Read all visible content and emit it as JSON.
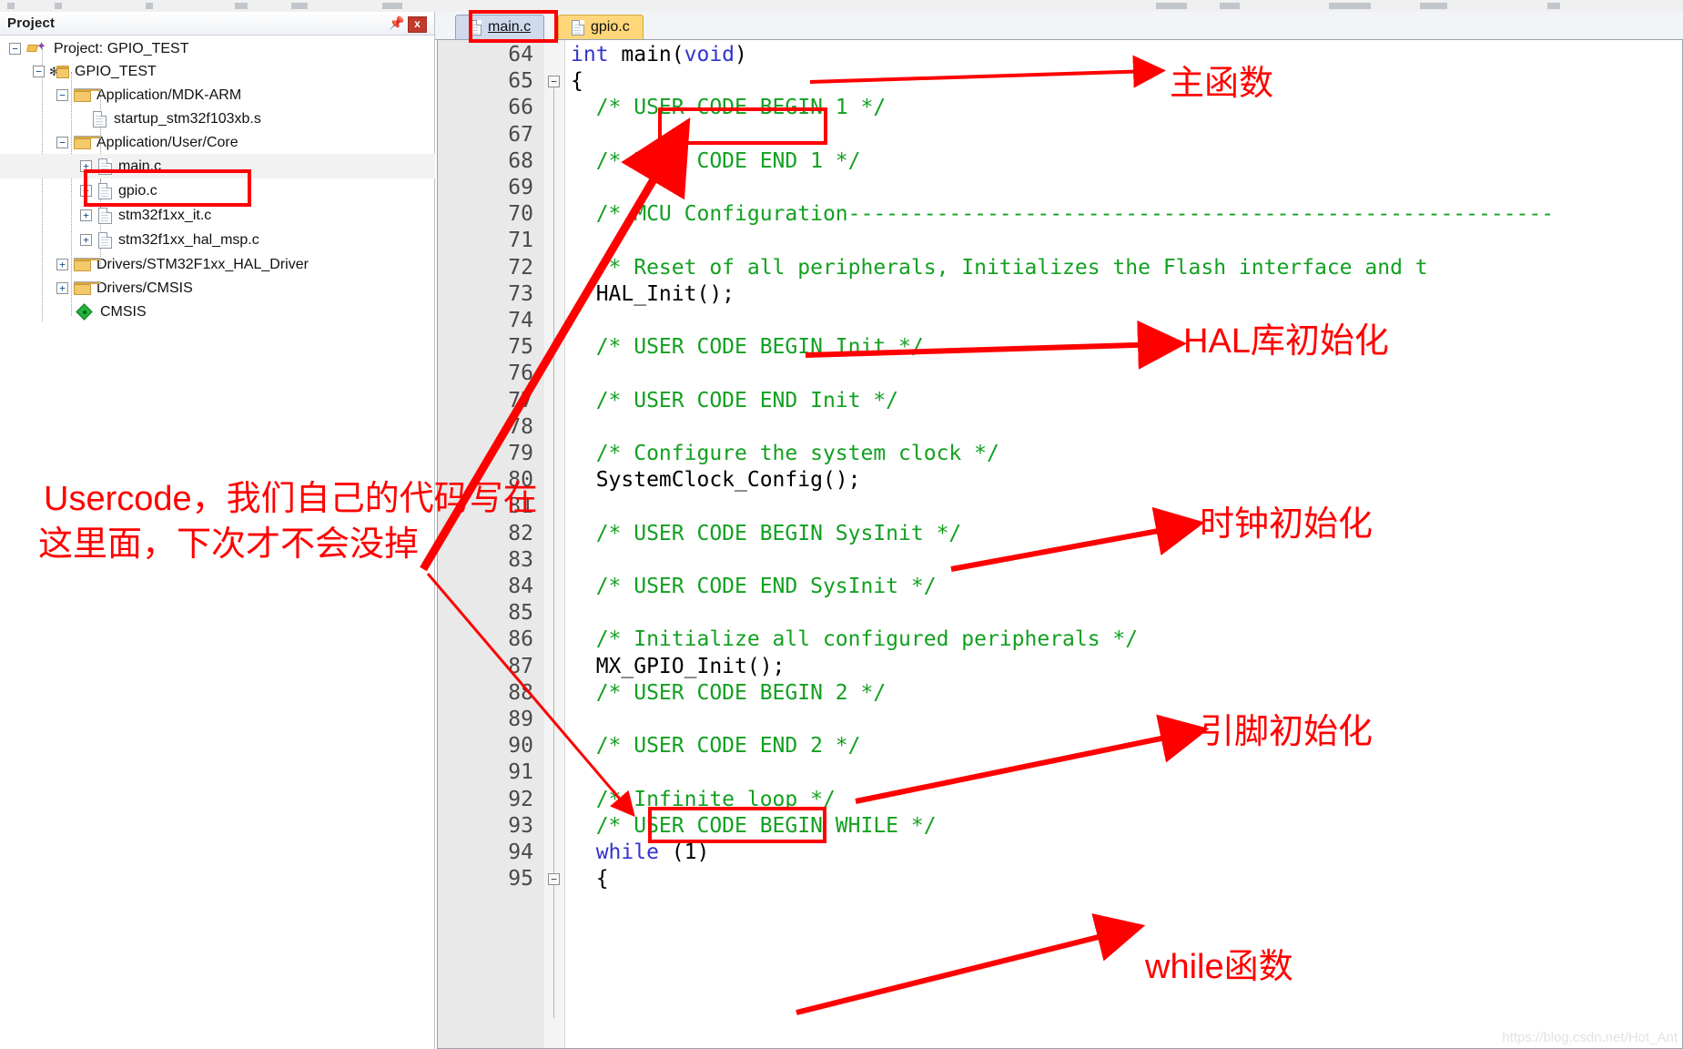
{
  "window": {
    "project_panel_title": "Project",
    "pin_icon": "pin-icon",
    "close_icon": "x"
  },
  "toolbar": {
    "icons": [
      "new-file-icon",
      "open-icon",
      "save-icon",
      "cut-icon",
      "copy-icon",
      "paste-icon",
      "undo-icon",
      "redo-icon",
      "build-icon",
      "debug-icon",
      "target-select",
      "options-icon"
    ]
  },
  "project_tree": [
    {
      "label": "Project: GPIO_TEST",
      "icon": "project-icon",
      "indent": 0,
      "expander": "-",
      "selected": false
    },
    {
      "label": "GPIO_TEST",
      "icon": "target-icon",
      "indent": 1,
      "expander": "-",
      "selected": false
    },
    {
      "label": "Application/MDK-ARM",
      "icon": "folder-icon",
      "indent": 2,
      "expander": "-",
      "selected": false
    },
    {
      "label": "startup_stm32f103xb.s",
      "icon": "file-icon",
      "indent": 3,
      "expander": "",
      "selected": false
    },
    {
      "label": "Application/User/Core",
      "icon": "folder-icon",
      "indent": 2,
      "expander": "-",
      "selected": false
    },
    {
      "label": "main.c",
      "icon": "file-icon",
      "indent": 3,
      "expander": "+",
      "selected": true
    },
    {
      "label": "gpio.c",
      "icon": "file-icon",
      "indent": 3,
      "expander": "+",
      "selected": false
    },
    {
      "label": "stm32f1xx_it.c",
      "icon": "file-icon",
      "indent": 3,
      "expander": "+",
      "selected": false
    },
    {
      "label": "stm32f1xx_hal_msp.c",
      "icon": "file-icon",
      "indent": 3,
      "expander": "+",
      "selected": false
    },
    {
      "label": "Drivers/STM32F1xx_HAL_Driver",
      "icon": "folder-icon",
      "indent": 2,
      "expander": "+",
      "selected": false
    },
    {
      "label": "Drivers/CMSIS",
      "icon": "folder-icon",
      "indent": 2,
      "expander": "+",
      "selected": false
    },
    {
      "label": "CMSIS",
      "icon": "cmsis-icon",
      "indent": 2,
      "expander": "",
      "selected": false
    }
  ],
  "editor": {
    "tabs": [
      {
        "label": "main.c",
        "active": true,
        "icon": "file-icon"
      },
      {
        "label": "gpio.c",
        "active": false,
        "icon": "file-icon"
      }
    ],
    "first_line": 64,
    "lines": [
      {
        "n": 64,
        "fold": "",
        "parts": [
          {
            "t": "int ",
            "c": "kw"
          },
          {
            "t": "main(",
            "c": "pln"
          },
          {
            "t": "void",
            "c": "kw"
          },
          {
            "t": ")",
            "c": "pln"
          }
        ]
      },
      {
        "n": 65,
        "fold": "-",
        "parts": [
          {
            "t": "{",
            "c": "pln"
          }
        ]
      },
      {
        "n": 66,
        "fold": "",
        "parts": [
          {
            "t": "  /* USER CODE BEGIN 1 */",
            "c": "com"
          }
        ]
      },
      {
        "n": 67,
        "fold": "",
        "parts": []
      },
      {
        "n": 68,
        "fold": "",
        "parts": [
          {
            "t": "  /* USER CODE END 1 */",
            "c": "com"
          }
        ]
      },
      {
        "n": 69,
        "fold": "",
        "parts": []
      },
      {
        "n": 70,
        "fold": "",
        "parts": [
          {
            "t": "  /* MCU Configuration--------------------------------------------------------",
            "c": "com"
          }
        ]
      },
      {
        "n": 71,
        "fold": "",
        "parts": []
      },
      {
        "n": 72,
        "fold": "",
        "parts": [
          {
            "t": "  /* Reset of all peripherals, Initializes the Flash interface and t",
            "c": "com"
          }
        ]
      },
      {
        "n": 73,
        "fold": "",
        "parts": [
          {
            "t": "  HAL_Init();",
            "c": "pln"
          }
        ]
      },
      {
        "n": 74,
        "fold": "",
        "parts": []
      },
      {
        "n": 75,
        "fold": "",
        "parts": [
          {
            "t": "  /* USER CODE BEGIN Init */",
            "c": "com"
          }
        ]
      },
      {
        "n": 76,
        "fold": "",
        "parts": []
      },
      {
        "n": 77,
        "fold": "",
        "parts": [
          {
            "t": "  /* USER CODE END Init */",
            "c": "com"
          }
        ]
      },
      {
        "n": 78,
        "fold": "",
        "parts": []
      },
      {
        "n": 79,
        "fold": "",
        "parts": [
          {
            "t": "  /* Configure the system clock */",
            "c": "com"
          }
        ]
      },
      {
        "n": 80,
        "fold": "",
        "parts": [
          {
            "t": "  SystemClock_Config();",
            "c": "pln"
          }
        ]
      },
      {
        "n": 81,
        "fold": "",
        "parts": []
      },
      {
        "n": 82,
        "fold": "",
        "parts": [
          {
            "t": "  /* USER CODE BEGIN SysInit */",
            "c": "com"
          }
        ]
      },
      {
        "n": 83,
        "fold": "",
        "parts": []
      },
      {
        "n": 84,
        "fold": "",
        "parts": [
          {
            "t": "  /* USER CODE END SysInit */",
            "c": "com"
          }
        ]
      },
      {
        "n": 85,
        "fold": "",
        "parts": []
      },
      {
        "n": 86,
        "fold": "",
        "parts": [
          {
            "t": "  /* Initialize all configured peripherals */",
            "c": "com"
          }
        ]
      },
      {
        "n": 87,
        "fold": "",
        "parts": [
          {
            "t": "  MX_GPIO_Init();",
            "c": "pln"
          }
        ]
      },
      {
        "n": 88,
        "fold": "",
        "parts": [
          {
            "t": "  /* USER CODE BEGIN 2 */",
            "c": "com"
          }
        ]
      },
      {
        "n": 89,
        "fold": "",
        "parts": []
      },
      {
        "n": 90,
        "fold": "",
        "parts": [
          {
            "t": "  /* USER CODE END 2 */",
            "c": "com"
          }
        ]
      },
      {
        "n": 91,
        "fold": "",
        "parts": []
      },
      {
        "n": 92,
        "fold": "",
        "parts": [
          {
            "t": "  /* Infinite loop */",
            "c": "com"
          }
        ]
      },
      {
        "n": 93,
        "fold": "",
        "parts": [
          {
            "t": "  /* USER CODE BEGIN WHILE */",
            "c": "com"
          }
        ]
      },
      {
        "n": 94,
        "fold": "",
        "parts": [
          {
            "t": "  while",
            "c": "kw"
          },
          {
            "t": " (1)",
            "c": "pln"
          }
        ]
      },
      {
        "n": 95,
        "fold": "-",
        "parts": [
          {
            "t": "  {",
            "c": "pln"
          }
        ]
      }
    ]
  },
  "annotations": [
    {
      "id": "main-function",
      "text": "主函数"
    },
    {
      "id": "hal-init",
      "text": "HAL库初始化"
    },
    {
      "id": "clock-init",
      "text": "时钟初始化"
    },
    {
      "id": "pin-init",
      "text": "引脚初始化"
    },
    {
      "id": "while-loop",
      "text": "while函数"
    },
    {
      "id": "usercode-line1",
      "text": "Usercode，我们自己的代码写在"
    },
    {
      "id": "usercode-line2",
      "text": "这里面，下次才不会没掉"
    }
  ],
  "colors": {
    "annotation_red": "#ff0000",
    "comment_green": "#12a020",
    "keyword_blue": "#3333cc",
    "active_tab": "#cfdaec",
    "inactive_tab": "#ffd77a"
  },
  "watermark": "https://blog.csdn.net/Hot_Ant"
}
